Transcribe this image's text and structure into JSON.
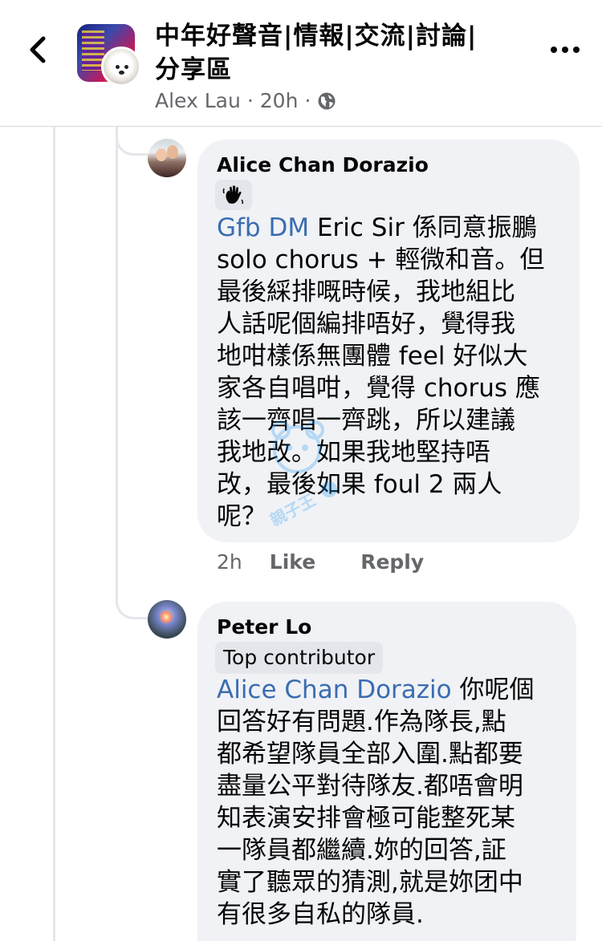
{
  "header": {
    "title": "中年好聲音|情報|交流|討論|分享區",
    "author": "Alex Lau",
    "time": "20h",
    "separator": "·"
  },
  "comments": [
    {
      "name": "Alice Chan Dorazio",
      "badge_icon": "waving-hand-icon",
      "mention": "Gfb DM",
      "text": " Eric Sir 係同意振鵬\nsolo chorus + 輕微和音。但\n最後綵排嘅時候，我地組比\n人話呢個編排唔好，覺得我\n地咁樣係無團體 feel 好似大\n家各自唱咁，覺得 chorus 應\n該一齊唱一齊跳，所以建議\n我地改。如果我地堅持唔\n改，最後如果 foul 2 兩人\n呢？",
      "time": "2h",
      "like": "Like",
      "reply": "Reply"
    },
    {
      "name": "Peter Lo",
      "badge": "Top contributor",
      "mention": "Alice Chan Dorazio",
      "text": " 你呢個\n回答好有問題.作為隊長,點\n都希望隊員全部入圍.點都要\n盡量公平對待隊友.都唔會明\n知表演安排會極可能整死某\n一隊員都繼續.妳的回答,証\n實了聽眾的猜測,就是妳团中\n有很多自私的隊員."
    }
  ],
  "watermark": {
    "text": "親子王",
    "sub": "Baby Kingdom"
  },
  "colors": {
    "bubble": "#f0f2f5",
    "mention": "#3a6db1",
    "meta": "#65676b"
  }
}
